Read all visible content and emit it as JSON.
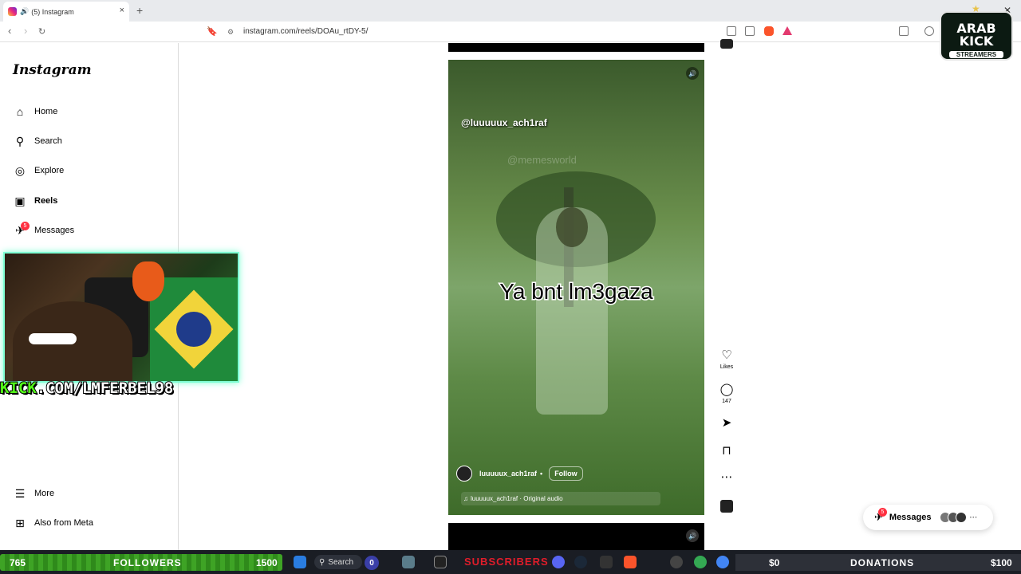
{
  "browser": {
    "tab_title": "(5) Instagram",
    "new_tab": "+",
    "close_tab": "×",
    "url": "instagram.com/reels/DOAu_rtDY-5/"
  },
  "sidebar": {
    "logo": "Instagram",
    "items": [
      {
        "label": "Home",
        "icon": "home-icon"
      },
      {
        "label": "Search",
        "icon": "search-icon"
      },
      {
        "label": "Explore",
        "icon": "compass-icon"
      },
      {
        "label": "Reels",
        "icon": "reels-icon"
      },
      {
        "label": "Messages",
        "icon": "messenger-icon",
        "badge": "5"
      }
    ],
    "bottom_items": [
      {
        "label": "More",
        "icon": "menu-icon"
      },
      {
        "label": "Also from Meta",
        "icon": "meta-icon"
      }
    ]
  },
  "webcam": {
    "kick_prefix": "KICK",
    "kick_url_rest": ".COM/LMFERBEL98"
  },
  "reel": {
    "handle_overlay": "@luuuuux_ach1raf",
    "watermark": "@memesworld",
    "caption": "Ya bnt lm3gaza",
    "author": "luuuuux_ach1raf",
    "follow_label": "Follow",
    "audio": "luuuuux_ach1raf · Original audio"
  },
  "actions": {
    "likes_label": "Likes",
    "comments_count": "147"
  },
  "messages_pill": {
    "label": "Messages",
    "badge": "5"
  },
  "overlay_logo": {
    "line1": "ARAB KICK",
    "line2": "STREAMERS"
  },
  "stream_bar": {
    "followers_current": "765",
    "followers_label": "FOLLOWERS",
    "followers_goal": "1500",
    "search_label": "Search",
    "notif_count": "0",
    "subscribers_label": "SUBSCRIBERS",
    "donations_current": "$0",
    "donations_label": "DONATIONS",
    "donations_goal": "$100"
  },
  "colors": {
    "kick_green": "#53fc18",
    "instagram_badge": "#ff3040",
    "subs_red": "#e11d2a"
  }
}
